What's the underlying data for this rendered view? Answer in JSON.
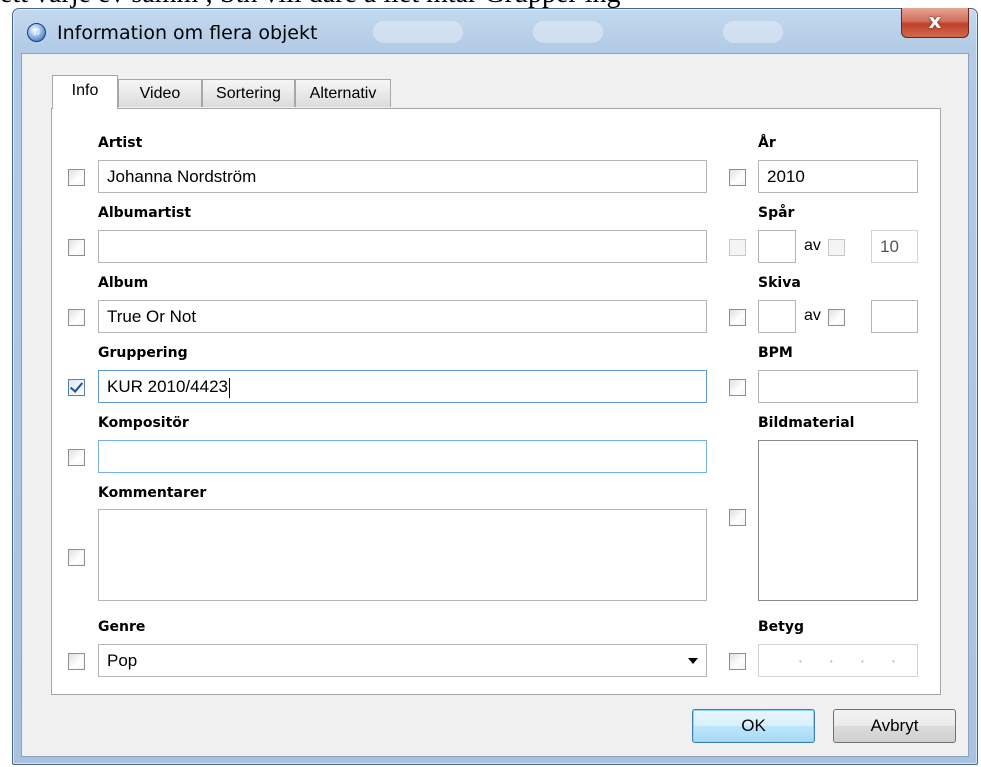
{
  "background_text": "ett varje ev samm ; Stn vill dare a liet mtar Grupper ing",
  "window": {
    "title": "Information om flera objekt",
    "close_glyph": "x"
  },
  "tabs": [
    {
      "label": "Info",
      "active": true
    },
    {
      "label": "Video",
      "active": false
    },
    {
      "label": "Sortering",
      "active": false
    },
    {
      "label": "Alternativ",
      "active": false
    }
  ],
  "fields": {
    "artist": {
      "label": "Artist",
      "value": "Johanna Nordström",
      "checked": false
    },
    "albumartist": {
      "label": "Albumartist",
      "value": "",
      "checked": false
    },
    "album": {
      "label": "Album",
      "value": "True Or Not",
      "checked": false
    },
    "gruppering": {
      "label": "Gruppering",
      "value": "KUR 2010/4423",
      "checked": true
    },
    "kompositor": {
      "label": "Kompositör",
      "value": "",
      "checked": false
    },
    "kommentarer": {
      "label": "Kommentarer",
      "value": "",
      "checked": false
    },
    "genre": {
      "label": "Genre",
      "value": "Pop",
      "checked": false
    },
    "ar": {
      "label": "År",
      "value": "2010",
      "checked": false
    },
    "spar": {
      "label": "Spår",
      "value": "",
      "of_label": "av",
      "of_value": "10",
      "checked": false
    },
    "skiva": {
      "label": "Skiva",
      "value": "",
      "of_label": "av",
      "of_value": "",
      "checked": false
    },
    "bpm": {
      "label": "BPM",
      "value": "",
      "checked": false
    },
    "bildmaterial": {
      "label": "Bildmaterial",
      "checked": false
    },
    "betyg": {
      "label": "Betyg",
      "stars": "• • • • •",
      "checked": false
    }
  },
  "buttons": {
    "ok": "OK",
    "cancel": "Avbryt"
  },
  "colors": {
    "titlebar": "#b3cbe6",
    "close": "#c0412a",
    "focus_border": "#5f9bd6",
    "check": "#1f4f9c"
  }
}
